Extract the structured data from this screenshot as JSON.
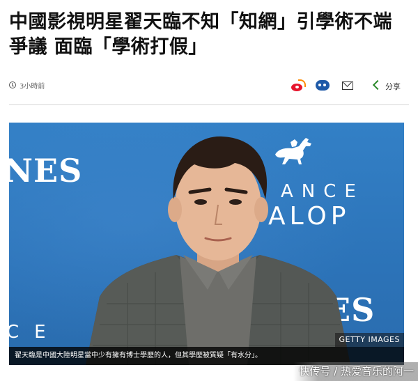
{
  "article": {
    "headline_line1": "中國影視明星翟天臨不知「知網」引學術不端",
    "headline_line2": "爭議 面臨「學術打假」",
    "timestamp": "3小時前"
  },
  "share_bar": {
    "icons": [
      "weibo-icon",
      "wechat-icon",
      "mail-icon",
      "share-icon"
    ],
    "share_label": "分享"
  },
  "photo": {
    "backdrop_words": [
      "NES",
      "ANCE",
      "ALOP",
      "NES",
      "CE"
    ],
    "watermark": "GETTY IMAGES",
    "caption": "翟天臨是中國大陸明星當中少有擁有博士學歷的人，但其學歷被質疑「有水分」。"
  },
  "source_overlay": "快传号 / 热爱音乐的阿一",
  "colors": {
    "backdrop_blue": "#2f78bd",
    "weibo_red": "#e6162d",
    "wechat_blue": "#1f5aa8",
    "share_green": "#2b8a2b"
  }
}
